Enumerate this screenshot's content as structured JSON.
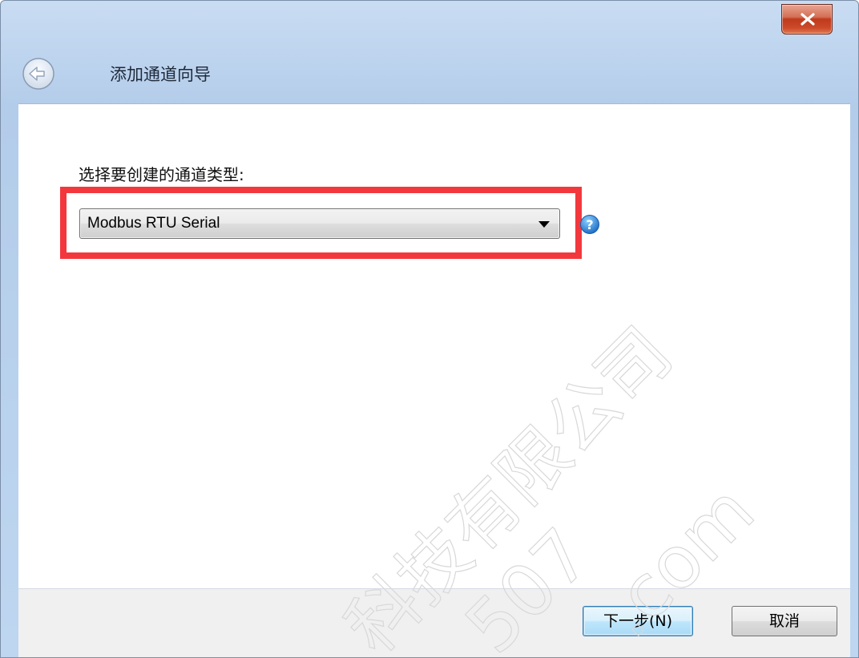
{
  "window": {
    "title": "添加通道向导",
    "close_label": "x"
  },
  "main": {
    "prompt": "选择要创建的通道类型:",
    "channel_type": {
      "selected": "Modbus RTU Serial"
    }
  },
  "footer": {
    "next_label": "下一步(N)",
    "cancel_label": "取消"
  },
  "watermark": {
    "line1": "科技有限公司",
    "line2": "507",
    "line3": ".com"
  },
  "icons": {
    "back": "back-arrow-icon",
    "help": "help-icon",
    "close": "close-icon",
    "dropdown": "chevron-down-icon"
  },
  "colors": {
    "highlight": "#f2383d",
    "help_blue": "#2a7fd4",
    "title_bar": "#bcd3ee"
  }
}
